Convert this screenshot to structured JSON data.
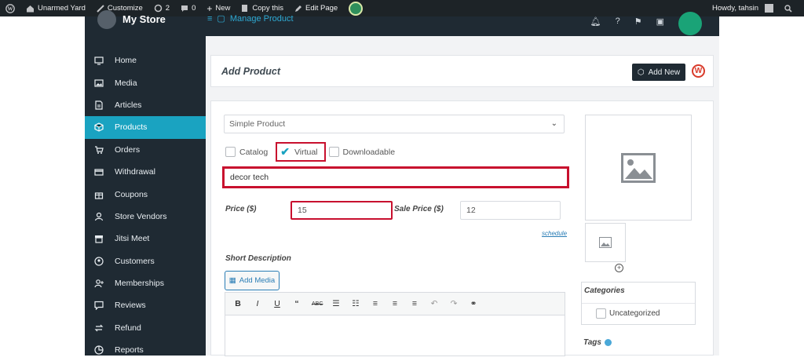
{
  "adminbar": {
    "site_name": "Unarmed Yard",
    "customize": "Customize",
    "updates_count": "2",
    "comments_count": "0",
    "new_label": "New",
    "copy_label": "Copy this",
    "edit_label": "Edit Page",
    "howdy": "Howdy, tahsin"
  },
  "topnav": {
    "store_title": "My Store",
    "manage_link": "Manage Product"
  },
  "sidebar": {
    "items": [
      {
        "label": "Home",
        "icon": "monitor-icon"
      },
      {
        "label": "Media",
        "icon": "image-icon"
      },
      {
        "label": "Articles",
        "icon": "document-icon"
      },
      {
        "label": "Products",
        "icon": "cube-icon",
        "active": true
      },
      {
        "label": "Orders",
        "icon": "cart-icon"
      },
      {
        "label": "Withdrawal",
        "icon": "card-icon"
      },
      {
        "label": "Coupons",
        "icon": "gift-icon"
      },
      {
        "label": "Store Vendors",
        "icon": "user-icon"
      },
      {
        "label": "Jitsi Meet",
        "icon": "store-icon"
      },
      {
        "label": "Customers",
        "icon": "user-circle-icon"
      },
      {
        "label": "Memberships",
        "icon": "user-plus-icon"
      },
      {
        "label": "Reviews",
        "icon": "chat-icon"
      },
      {
        "label": "Refund",
        "icon": "refund-icon"
      },
      {
        "label": "Reports",
        "icon": "reports-icon"
      }
    ]
  },
  "header": {
    "title": "Add Product",
    "add_new": "Add New"
  },
  "form": {
    "product_type": "Simple Product",
    "catalog_label": "Catalog",
    "virtual_label": "Virtual",
    "downloadable_label": "Downloadable",
    "product_name": "decor tech",
    "price_label": "Price ($)",
    "price_value": "15",
    "sale_price_label": "Sale Price ($)",
    "sale_price_value": "12",
    "schedule_label": "schedule",
    "short_description_label": "Short Description",
    "add_media_label": "Add Media"
  },
  "right_panel": {
    "categories_title": "Categories",
    "category_item": "Uncategorized",
    "tags_label": "Tags"
  },
  "colors": {
    "sidebar_bg": "#1f2a33",
    "active_item": "#1aa3c1",
    "highlight_red": "#c8102e",
    "link_blue": "#2a7db5"
  }
}
